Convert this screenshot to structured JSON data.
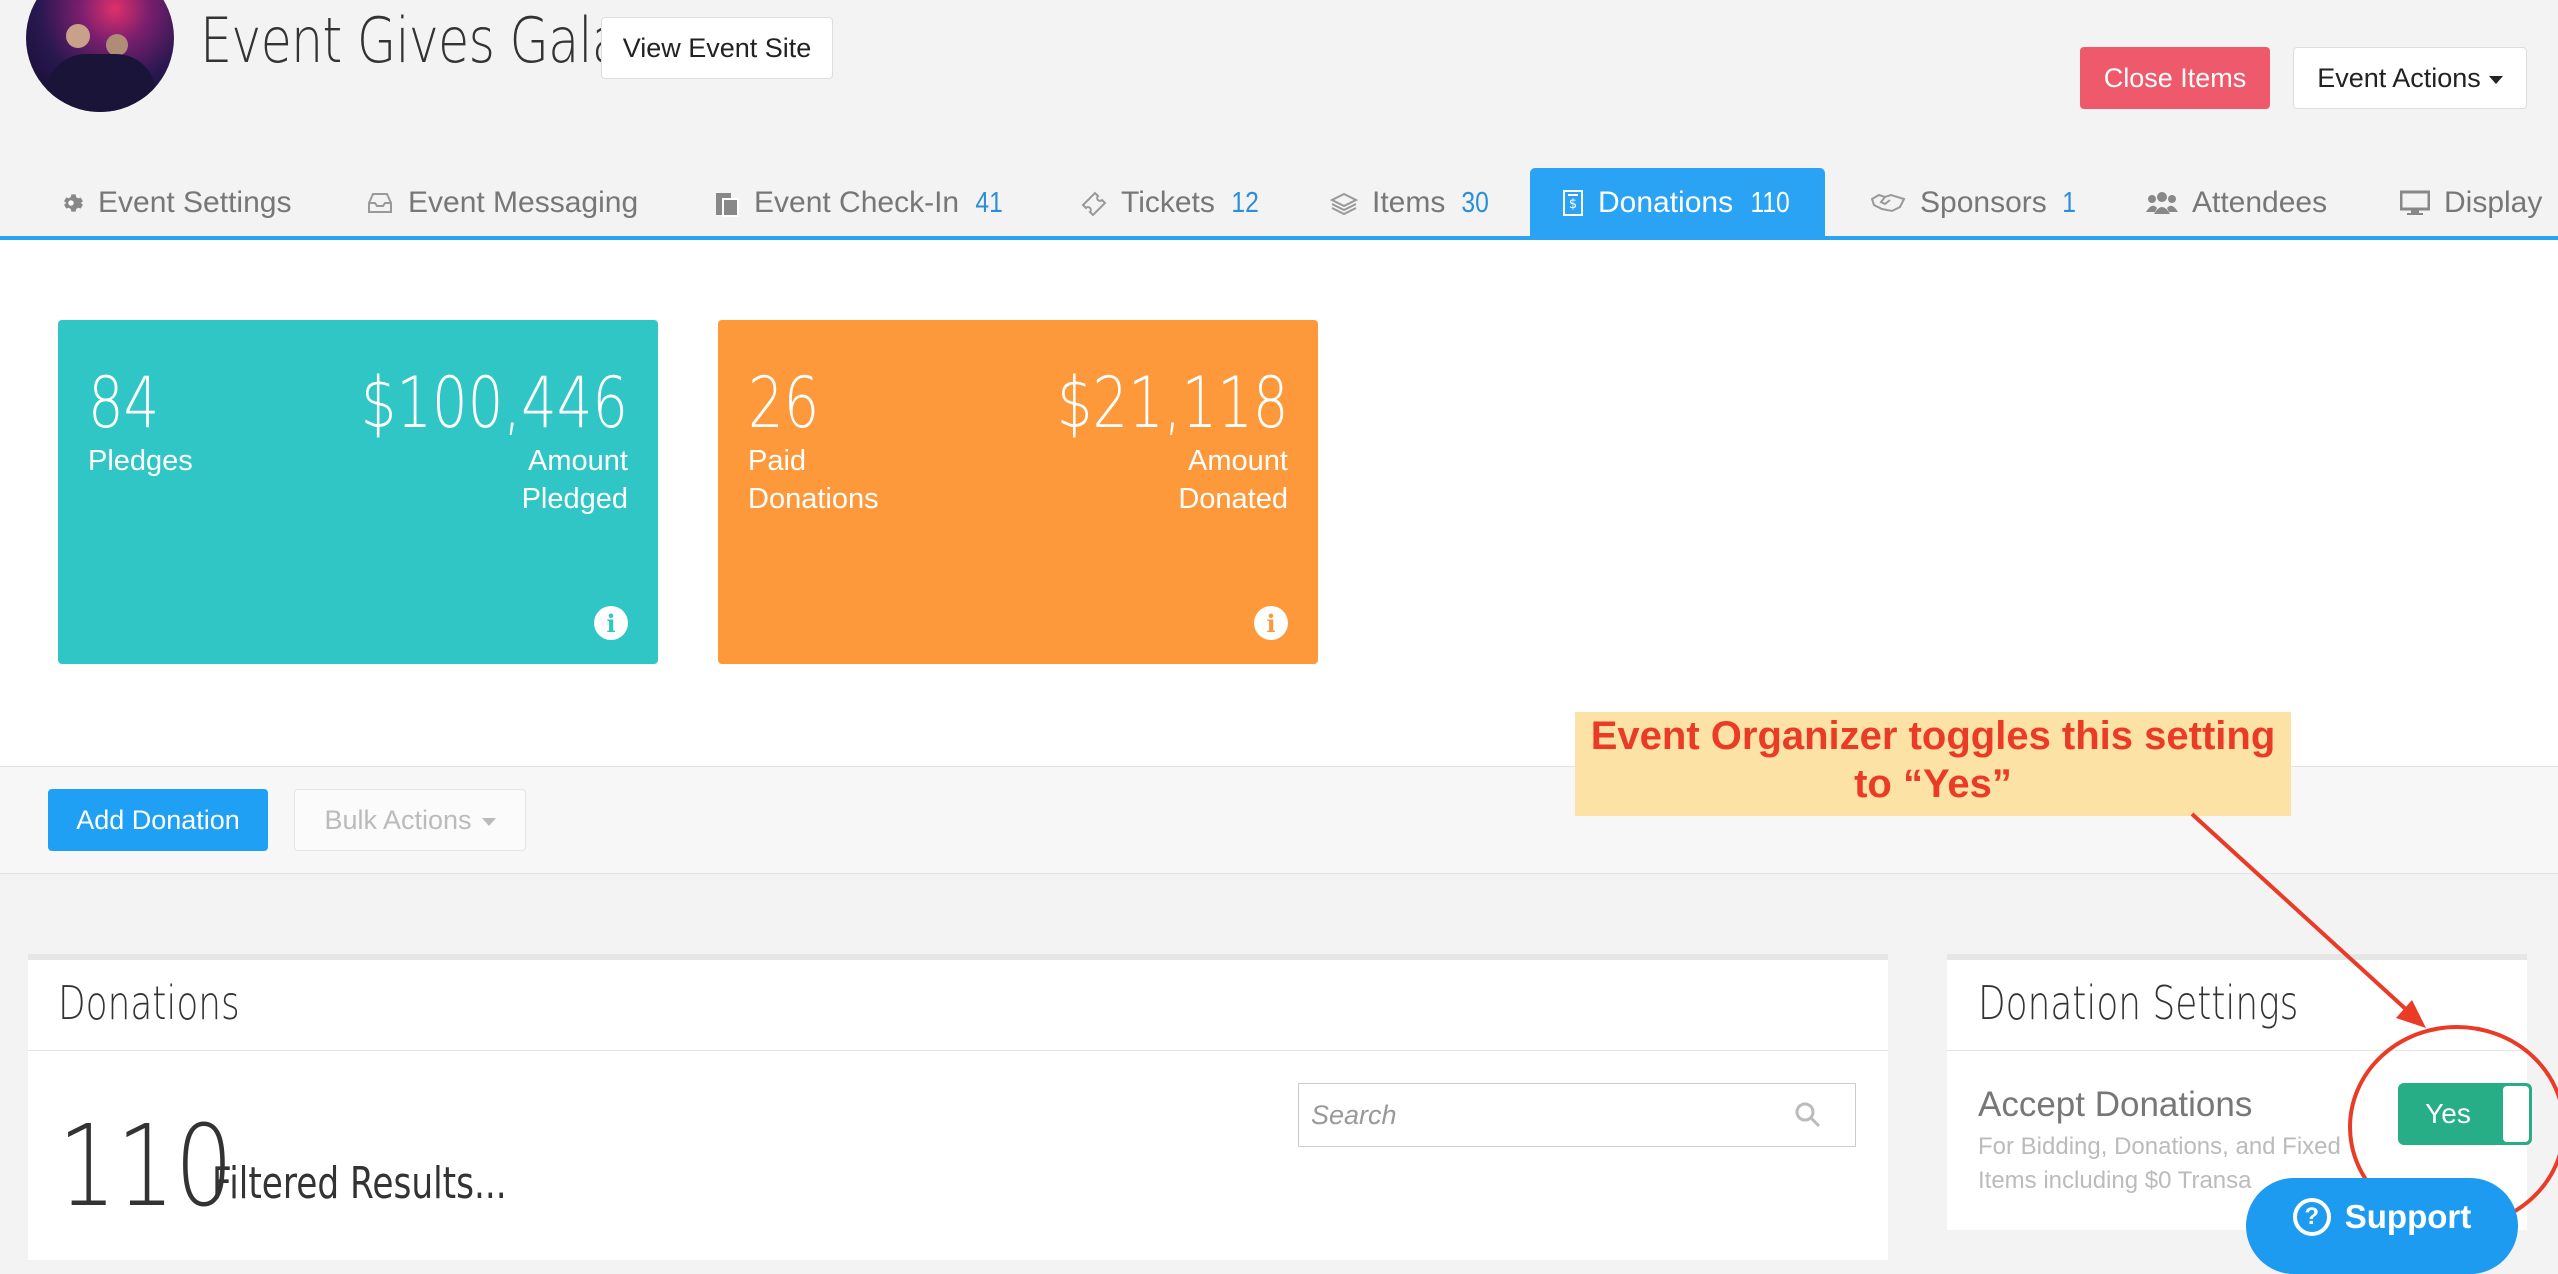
{
  "header": {
    "title": "Event Gives Gala",
    "view_site_label": "View Event Site",
    "close_items_label": "Close Items",
    "event_actions_label": "Event Actions"
  },
  "tabs": [
    {
      "label": "Event Settings",
      "count": "",
      "icon": "gear-icon"
    },
    {
      "label": "Event Messaging",
      "count": "",
      "icon": "inbox-icon"
    },
    {
      "label": "Event Check-In",
      "count": "41",
      "icon": "clipboard-icon"
    },
    {
      "label": "Tickets",
      "count": "12",
      "icon": "ticket-icon"
    },
    {
      "label": "Items",
      "count": "30",
      "icon": "layers-icon"
    },
    {
      "label": "Donations",
      "count": "110",
      "icon": "receipt-icon",
      "active": true
    },
    {
      "label": "Sponsors",
      "count": "1",
      "icon": "handshake-icon"
    },
    {
      "label": "Attendees",
      "count": "",
      "icon": "users-icon"
    },
    {
      "label": "Display",
      "count": "",
      "icon": "monitor-icon"
    }
  ],
  "cards": {
    "pledges": {
      "count": "84",
      "count_label": "Pledges",
      "amount": "$100,446",
      "amount_label_1": "Amount",
      "amount_label_2": "Pledged",
      "color": "#31c6c6"
    },
    "donations": {
      "count": "26",
      "count_label_1": "Paid",
      "count_label_2": "Donations",
      "amount": "$21,118",
      "amount_label_1": "Amount",
      "amount_label_2": "Donated",
      "color": "#fd993a"
    }
  },
  "toolbar": {
    "add_label": "Add Donation",
    "bulk_label": "Bulk Actions"
  },
  "donations_panel": {
    "title": "Donations",
    "search_placeholder": "Search",
    "count": "110",
    "filtered_label": "Filtered Results..."
  },
  "settings_panel": {
    "title": "Donation Settings",
    "accept_label": "Accept Donations",
    "accept_desc_1": "For Bidding, Donations, and Fixed",
    "accept_desc_2": "Items including $0 Transa",
    "toggle_label": "Yes"
  },
  "annotation": {
    "line1": "Event Organizer toggles this setting",
    "line2": "to “Yes”",
    "color": "#ea3b27"
  },
  "support": {
    "label": "Support"
  }
}
